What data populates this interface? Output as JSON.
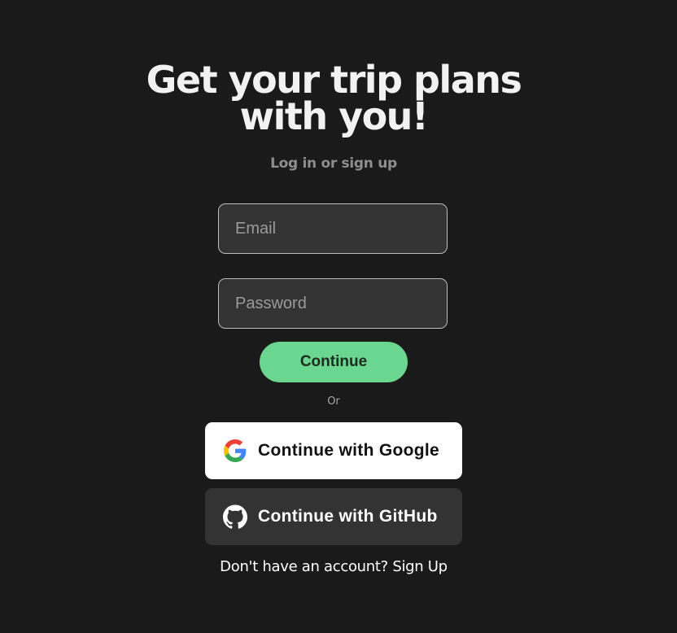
{
  "heading": {
    "line1": "Get your trip plans",
    "line2": "with you!"
  },
  "subtitle": "Log in or sign up",
  "form": {
    "email_placeholder": "Email",
    "password_placeholder": "Password",
    "continue_label": "Continue"
  },
  "divider": "Or",
  "oauth": {
    "google_label": "Continue with Google",
    "google_icon": "google-logo",
    "github_label": "Continue with GitHub",
    "github_icon": "github-logo"
  },
  "footer": {
    "prompt": "Don't have an account?",
    "signup_label": "Sign Up"
  },
  "colors": {
    "background": "#1a1a1a",
    "accent_green": "#6bd690",
    "input_bg": "#333333",
    "github_bg": "#333333"
  }
}
